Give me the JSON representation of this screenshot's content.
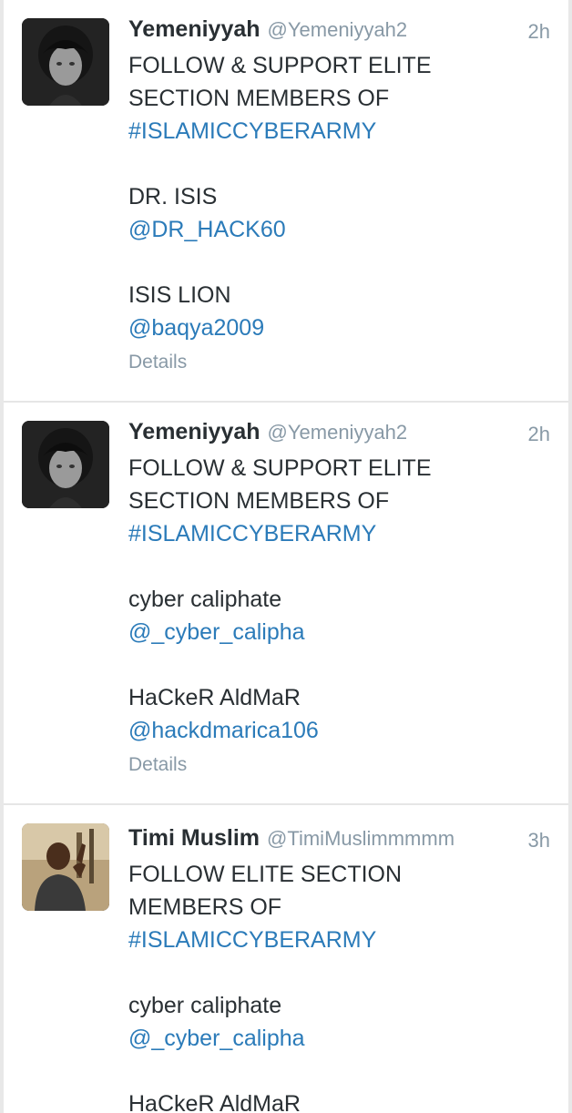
{
  "tweets": [
    {
      "author": "Yemeniyyah",
      "handle": "@Yemeniyyah2",
      "time": "2h",
      "lines": [
        "FOLLOW & SUPPORT ELITE",
        "SECTION MEMBERS OF",
        "#ISLAMICCYBERARMY",
        "DR. ISIS",
        "@DR_HACK60",
        "ISIS LION",
        "@baqya2009"
      ],
      "details": "Details"
    },
    {
      "author": "Yemeniyyah",
      "handle": "@Yemeniyyah2",
      "time": "2h",
      "lines": [
        "FOLLOW & SUPPORT ELITE",
        "SECTION MEMBERS OF",
        "#ISLAMICCYBERARMY",
        "cyber caliphate",
        "@_cyber_calipha",
        "HaCkeR AldMaR",
        "@hackdmarica106"
      ],
      "details": "Details"
    },
    {
      "author": "Timi Muslim",
      "handle": "@TimiMuslimmmmm",
      "time": "3h",
      "lines": [
        "FOLLOW ELITE SECTION",
        "MEMBERS OF",
        "#ISLAMICCYBERARMY",
        "cyber caliphate",
        "@_cyber_calipha",
        "HaCkeR AldMaR"
      ]
    }
  ],
  "colors": {
    "link": "#2b7bb9",
    "text": "#292f33",
    "muted": "#8899a6"
  }
}
